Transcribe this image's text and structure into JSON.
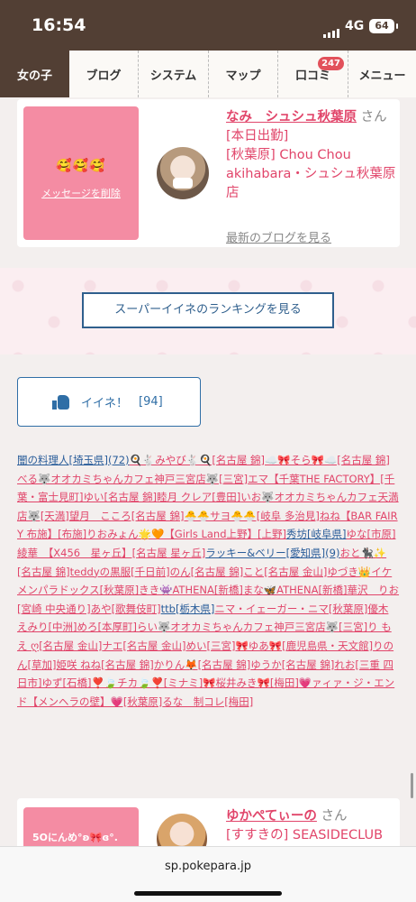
{
  "status_bar": {
    "time": "16:54",
    "network": "4G",
    "battery": "64"
  },
  "nav": {
    "tabs": [
      {
        "label": "女の子",
        "active": true
      },
      {
        "label": "ブログ"
      },
      {
        "label": "システム"
      },
      {
        "label": "マップ"
      },
      {
        "label": "口コミ",
        "badge": "247"
      },
      {
        "label": "メニュー"
      }
    ]
  },
  "card1": {
    "emoji": "🥰🥰🥰",
    "delete_label": "メッセージを削除",
    "name": "なみ　シュシュ秋葉原",
    "suffix": "さん",
    "status": "[本日出勤]",
    "shop": "[秋葉原] Chou Chou akihabara・シュシュ秋葉原店",
    "blog_link": "最新のブログを見る"
  },
  "ranking_button": "スーパーイイネのランキングを見る",
  "like_button": {
    "label": "イイネ！",
    "count": "[94]"
  },
  "likers": [
    {
      "t": "闇の料理人[埼玉県](72)",
      "c": "blue"
    },
    {
      "t": "🍳🐇みやび🐇🍳[名古屋 錦]"
    },
    {
      "t": "☁️🎀そら🎀☁️[名古屋 錦]"
    },
    {
      "t": "べる🐺オオカミちゃんカフェ神戸三宮店🐺[三宮]"
    },
    {
      "t": "エマ【千葉THE FACTORY】[千葉・富士見町]"
    },
    {
      "t": "ゆい[名古屋 錦]"
    },
    {
      "t": "睦月 クレア[豊田]"
    },
    {
      "t": "いお🐺オオカミちゃんカフェ天満店🐺[天満]"
    },
    {
      "t": "望月　こころ[名古屋 錦]"
    },
    {
      "t": "🐣🐣サヨ🐣🐣[岐阜 多治見]"
    },
    {
      "t": "ねね【BAR FAIRY 布施】[布施]"
    },
    {
      "t": "りおみょん🌟🧡【Girls Land上野】[上野]"
    },
    {
      "t": "秀坊[岐阜県]",
      "c": "blue"
    },
    {
      "t": "ゆな[市原]"
    },
    {
      "t": "綾華　【X456　星ヶ丘】[名古屋 星ヶ丘]"
    },
    {
      "t": "ラッキー&ベリー[愛知県](9)",
      "c": "blue"
    },
    {
      "t": "おと🐈‍⬛✨[名古屋 錦]"
    },
    {
      "t": "teddyの黒服[千日前]"
    },
    {
      "t": "のん[名古屋 錦]"
    },
    {
      "t": "こと[名古屋 金山]"
    },
    {
      "t": "ゆづき👑イケメンパラドックス[秋葉原]"
    },
    {
      "t": "きき👾ATHENA[新橋]"
    },
    {
      "t": "まな🦋ATHENA[新橋]"
    },
    {
      "t": "華沢　りお[宮崎 中央通り]"
    },
    {
      "t": "あや[歌舞伎町]"
    },
    {
      "t": "ttb[栃木県]",
      "c": "blue"
    },
    {
      "t": "ニマ・イェーガー・ニマ[秋葉原]"
    },
    {
      "t": "優木 えみり[中洲]"
    },
    {
      "t": "めろ[本厚町]"
    },
    {
      "t": "らい🐺オオカミちゃんカフェ神戸三宮店🐺[三宮]"
    },
    {
      "t": "り も え ღ[名古屋 金山]"
    },
    {
      "t": "ナエ[名古屋 金山]"
    },
    {
      "t": "めい[三宮]"
    },
    {
      "t": "🎀ゆあ🎀[鹿児島県・天文館]"
    },
    {
      "t": "りのん[草加]"
    },
    {
      "t": "姫咲 ねね[名古屋 錦]"
    },
    {
      "t": "かりん🦊[名古屋 錦]"
    },
    {
      "t": "ゆうか[名古屋 錦]"
    },
    {
      "t": "れお[三重 四日市]"
    },
    {
      "t": "ゆず[石橋]"
    },
    {
      "t": "❣️🍃チカ🍃❣️[ミナミ]"
    },
    {
      "t": "🎀桜井みき🎀[梅田]"
    },
    {
      "t": "💗ァィァ・ジ・エンド【メンヘラの壁】💗[秋葉原]"
    },
    {
      "t": "るな　制コレ[梅田]"
    }
  ],
  "card2": {
    "message": "5Oにんめ°ʚ🎀ɞ°.",
    "name": "ゆかぺてぃーの",
    "suffix": "さん",
    "shop": "[すすきの] SEASIDECLUB"
  },
  "url_bar": {
    "url": "sp.pokepara.jp"
  }
}
